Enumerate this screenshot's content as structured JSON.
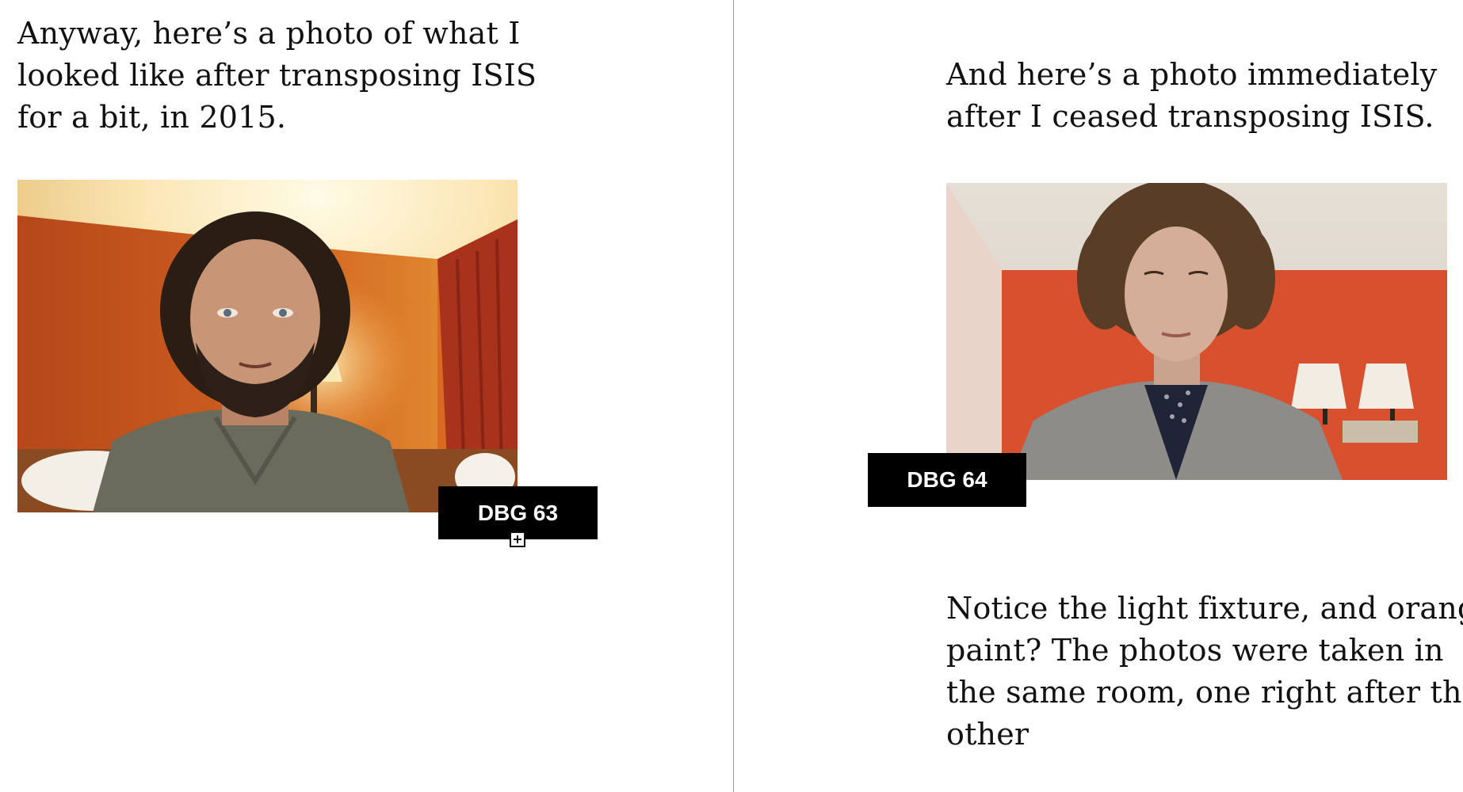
{
  "left_page": {
    "intro_lines": [
      "Anyway, here’s a photo of what I",
      "looked like after transposing ISIS",
      "for a bit, in 2015."
    ],
    "photo_tag": "DBG 63",
    "expand_icon": "plus-square-icon"
  },
  "right_page": {
    "intro_lines": [
      "And here’s a photo immediately",
      "after I ceased transposing ISIS."
    ],
    "photo_tag": "DBG 64",
    "notice_lines": [
      "Notice the light fixture, and orange",
      "paint? The photos were taken in",
      "the same room, one right after the",
      "other"
    ]
  },
  "colors": {
    "orange_wall": "#c4531a",
    "tag_background": "#000000",
    "divider": "#9a9a9a"
  }
}
